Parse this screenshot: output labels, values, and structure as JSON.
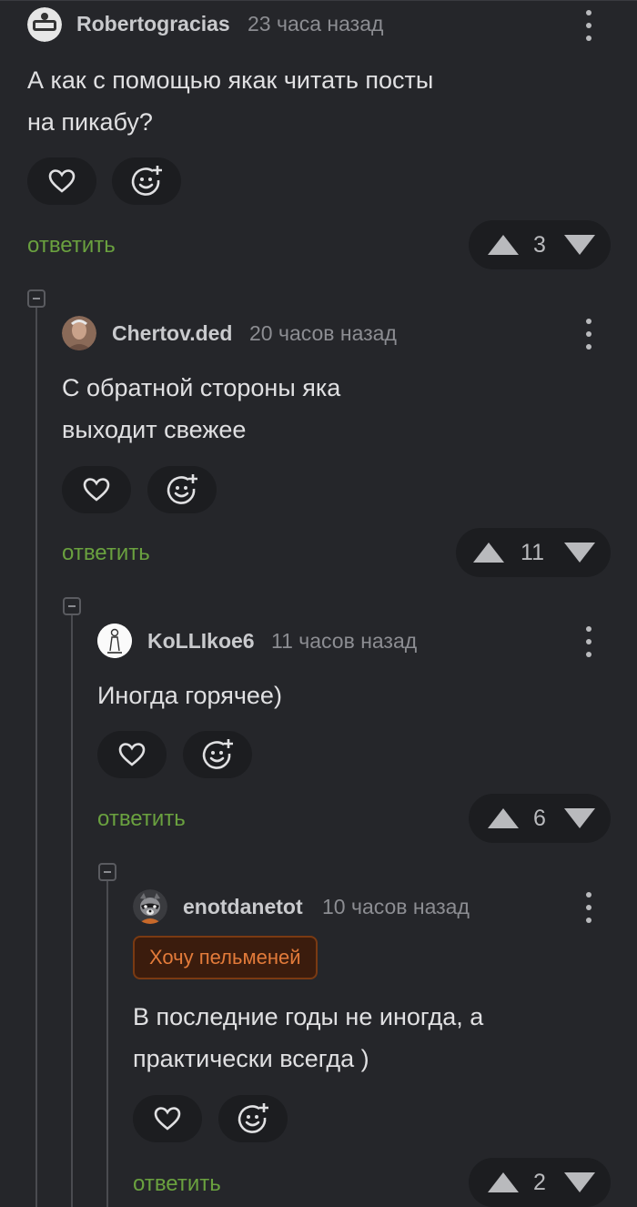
{
  "colors": {
    "background": "#25262a",
    "reply_green": "#6aa13f",
    "badge_orange": "#e37b3a",
    "badge_bg": "#3b1c0d"
  },
  "comments": [
    {
      "username": "Robertogracias",
      "time": "23 часа назад",
      "text_lines": [
        "А как с помощью якак читать посты",
        "на пикабу?"
      ],
      "reply_label": "ответить",
      "score": "3",
      "avatar_icon": "user-avatar"
    },
    {
      "username": "Chertov.ded",
      "time": "20 часов назад",
      "text_lines": [
        "С обратной стороны яка",
        "выходит свежее"
      ],
      "reply_label": "ответить",
      "score": "11",
      "avatar_icon": "user-avatar"
    },
    {
      "username": "KoLLIkoe6",
      "time": "11 часов назад",
      "text_lines": [
        "Иногда горячее)"
      ],
      "reply_label": "ответить",
      "score": "6",
      "avatar_icon": "user-avatar"
    },
    {
      "username": "enotdanetot",
      "time": "10 часов назад",
      "badge": "Хочу пельменей",
      "text_lines": [
        "В последние годы не иногда, а",
        "практически всегда )"
      ],
      "reply_label": "ответить",
      "score": "2",
      "avatar_icon": "raccoon-avatar"
    }
  ],
  "icons": {
    "like": "heart-icon",
    "react": "smile-plus-icon",
    "menu": "more-vertical-icon",
    "upvote": "arrow-up-icon",
    "downvote": "arrow-down-icon",
    "collapse": "collapse-thread-icon"
  }
}
